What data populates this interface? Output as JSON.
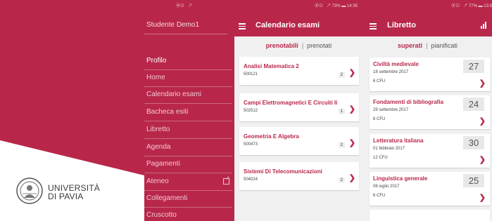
{
  "status_bars": {
    "drawer": "⦿⊙  ↗",
    "calendario": "⦿⊙  ↗ 73% ▬ 14:35",
    "libretto": "⦿⊙  ↗ 77% ▬ 13:5"
  },
  "drawer": {
    "user": "Studente Demo1",
    "items": [
      {
        "label": "Profilo",
        "active": true
      },
      {
        "label": "Home"
      },
      {
        "label": "Calendario esami"
      },
      {
        "label": "Bacheca esiti"
      },
      {
        "label": "Libretto"
      },
      {
        "label": "Agenda"
      },
      {
        "label": "Pagamenti"
      },
      {
        "label": "Ateneo",
        "external": true
      },
      {
        "label": "Collegamenti"
      },
      {
        "label": "Cruscotto"
      }
    ]
  },
  "logo": {
    "line1": "UNIVERSITÀ",
    "line2": "DI PAVIA"
  },
  "calendario": {
    "title": "Calendario esami",
    "tab_active": "prenotabili",
    "tab_separator": "|",
    "tab_inactive": "prenotati",
    "exams": [
      {
        "name": "Analisi Matematica 2",
        "code": "500121",
        "count": "2"
      },
      {
        "name": "Campi Elettromagnetici E Circuiti Ii",
        "code": "502512",
        "count": "1"
      },
      {
        "name": "Geometria E Algebra",
        "code": "500473",
        "count": "2"
      },
      {
        "name": "Sistemi Di Telecomunicazioni",
        "code": "504024",
        "count": "2"
      }
    ],
    "chevron": "❯"
  },
  "libretto": {
    "title": "Libretto",
    "tab_active": "superati",
    "tab_separator": "|",
    "tab_inactive": "pianificati",
    "courses": [
      {
        "name": "Civiltà medievale",
        "date": "18 settembre 2017",
        "cfu": "6 CFU",
        "grade": "27"
      },
      {
        "name": "Fondamenti di bibliografia",
        "date": "29 settembre 2017",
        "cfu": "6 CFU",
        "grade": "24"
      },
      {
        "name": "Letteratura italiana",
        "date": "01 febbraio 2017",
        "cfu": "12 CFU",
        "grade": "30"
      },
      {
        "name": "Linguistica generale",
        "date": "06 luglio 2017",
        "cfu": "6 CFU",
        "grade": "25"
      }
    ],
    "chevron": "❯"
  },
  "colors": {
    "brand": "#b8274a",
    "card": "#ffffff",
    "background": "#f0f0f0"
  }
}
